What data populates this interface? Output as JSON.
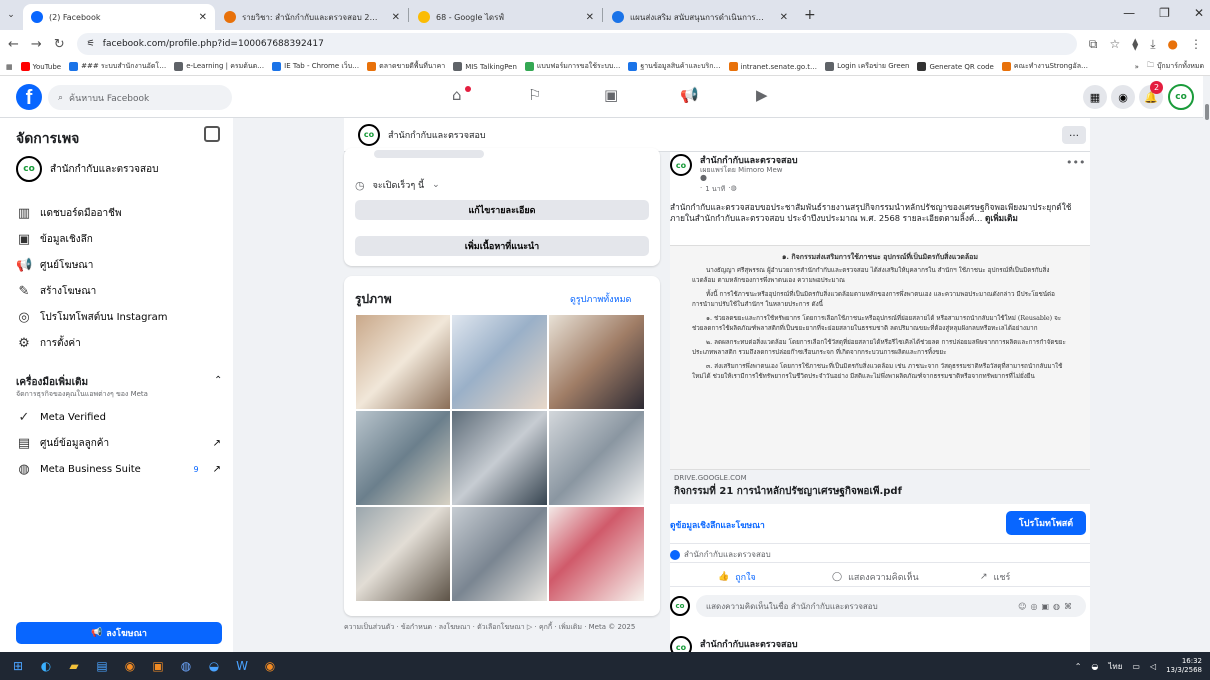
{
  "browser": {
    "tabs": [
      {
        "title": "(2) Facebook",
        "active": true,
        "fav_color": "#0866ff"
      },
      {
        "title": "รายวิชา: สำนักกำกับและตรวจสอบ 2…",
        "active": false,
        "fav_color": "#e8710a"
      },
      {
        "title": "68 - Google ไดรฟ์",
        "active": false,
        "fav_color": "#1a73e8"
      },
      {
        "title": "แผนส่งเสริม สนับสนุนการดำเนินการ…",
        "active": false,
        "fav_color": "#1a73e8"
      }
    ],
    "url": "facebook.com/profile.php?id=100067688392417",
    "bookmarks": [
      {
        "label": "YouTube",
        "color": "#ff0000"
      },
      {
        "label": "### ระบบสำนักงานอัตโ…",
        "color": "#1a73e8"
      },
      {
        "label": "e-Learning | ครมต้นต…",
        "color": "#5f6368"
      },
      {
        "label": "IE Tab - Chrome เว็บ…",
        "color": "#1a73e8"
      },
      {
        "label": "ตลาดขายดีพื้นที่นาคา",
        "color": "#e8710a"
      },
      {
        "label": "MIS TalkingPen",
        "color": "#5f6368"
      },
      {
        "label": "แบบฟอร์มการขอใช้ระบบ…",
        "color": "#34a853"
      },
      {
        "label": "ฐานข้อมูลสินค้าและบริก…",
        "color": "#1a73e8"
      },
      {
        "label": "intranet.senate.go.t…",
        "color": "#e8710a"
      },
      {
        "label": "Login เครือข่าย Green",
        "color": "#5f6368"
      },
      {
        "label": "Generate QR code",
        "color": "#333333"
      },
      {
        "label": "คณะทำงานStrongอัล…",
        "color": "#e8710a"
      }
    ],
    "bookmarks_folder": "บุ๊กมาร์กทั้งหมด"
  },
  "fb": {
    "search_placeholder": "ค้นหาบน Facebook",
    "notif_count": "2",
    "sidebar": {
      "title": "จัดการเพจ",
      "page_name": "สำนักกำกับและตรวจสอบ",
      "items": [
        {
          "label": "แดชบอร์ดมืออาชีพ",
          "icon": "dashboard-icon",
          "glyph": "▥"
        },
        {
          "label": "ข้อมูลเชิงลึก",
          "icon": "insights-icon",
          "glyph": "▣"
        },
        {
          "label": "ศูนย์โฆษณา",
          "icon": "megaphone-icon",
          "glyph": "📢"
        },
        {
          "label": "สร้างโฆษณา",
          "icon": "pencil-icon",
          "glyph": "✎"
        },
        {
          "label": "โปรโมทโพสต์บน Instagram",
          "icon": "instagram-icon",
          "glyph": "◎"
        },
        {
          "label": "การตั้งค่า",
          "icon": "gear-icon",
          "glyph": "⚙"
        }
      ],
      "tools_title": "เครื่องมือเพิ่มเติม",
      "tools_sub": "จัดการธุรกิจของคุณในแอพต่างๆ ของ Meta",
      "tools": [
        {
          "label": "Meta Verified",
          "icon": "verified-icon",
          "glyph": "✓",
          "badge": "",
          "arrow": ""
        },
        {
          "label": "ศูนย์ข้อมูลลูกค้า",
          "icon": "contacts-icon",
          "glyph": "▤",
          "badge": "",
          "arrow": "↗"
        },
        {
          "label": "Meta Business Suite",
          "icon": "business-suite-icon",
          "glyph": "◍",
          "badge": "9",
          "arrow": "↗"
        }
      ],
      "ad_button": "ลงโฆษณา"
    },
    "page_header": {
      "name": "สำนักกำกับและตรวจสอบ",
      "more": "…"
    },
    "intro": {
      "hours": "จะเปิดเร็วๆ นี้",
      "edit_details": "แก้ไขรายละเอียด",
      "add_featured": "เพิ่มเนื้อหาที่แนะนำ"
    },
    "photos": {
      "title": "รูปภาพ",
      "see_all": "ดูรูปภาพทั้งหมด"
    },
    "footer": "ความเป็นส่วนตัว · ข้อกำหนด · ลงโฆษณา · ตัวเลือกโฆษณา ▷ · คุกกี้ · เพิ่มเติม · Meta © 2025",
    "post": {
      "author": "สำนักกำกับและตรวจสอบ",
      "posted_by": "เผยแพร่โดย Mimoro Mew",
      "time": "1 นาที",
      "text1": "สำนักกำกับและตรวจสอบขอประชาสัมพันธ์รายงานสรุปกิจกรรมนำหลักปรัชญาของเศรษฐกิจพอเพียงมาประยุกต์ใช้",
      "text2": "ภายในสำนักกำกับและตรวจสอบ ประจำปีงบประมาณ พ.ศ. 2568 รายละเอียดตามลิ้งค์...",
      "see_more": "ดูเพิ่มเติม",
      "doc_heading": "๑. กิจกรรมส่งเสริมการใช้ภาชนะ อุปกรณ์ที่เป็นมิตรกับสิ่งแวดล้อม",
      "doc_p1": "นางธัญญา ศรีสุพรรณ ผู้อำนวยการสำนักกำกับและตรวจสอบ ได้ส่งเสริมให้บุคลากรใน สำนักฯ ใช้ภาชนะ อุปกรณ์ที่เป็นมิตรกับสิ่งแวดล้อม ตามหลักของการพึ่งพาตนเอง ความพอประมาณ",
      "doc_p2": "ทั้งนี้ การใช้ภาชนะหรืออุปกรณ์ที่เป็นมิตรกับสิ่งแวดล้อมตามหลักของการพึ่งพาตนเอง และความพอประมาณดังกล่าว มีประโยชน์ต่อการนำมาปรับใช้ในสำนักฯ ในหลายประการ ดังนี้",
      "doc_p3": "๑. ช่วยลดขยะและการใช้ทรัพยากร โดยการเลือกใช้ภาชนะหรืออุปกรณ์ที่ย่อยสลายได้ หรือสามารถนำกลับมาใช้ใหม่ (Reusable) จะช่วยลดการใช้ผลิตภัณฑ์พลาสติกที่เป็นขยะยากที่จะย่อยสลายในธรรมชาติ ลดปริมาณขยะที่ต้องสู่หลุมฝังกลบหรือทะเลได้อย่างมาก",
      "doc_p4": "๒. ลดผลกระทบต่อสิ่งแวดล้อม โดยการเลือกใช้วัสดุที่ย่อยสลายได้หรือรีไซเคิลได้ช่วยลด การปล่อยมลพิษจากการผลิตและการกำจัดขยะประเภทพลาสติก รวมถึงลดการปล่อยก๊าซเรือนกระจก ที่เกิดจากกระบวนการผลิตและการทิ้งขยะ",
      "doc_p5": "๓. ส่งเสริมการพึ่งพาตนเอง โดยการใช้ภาชนะที่เป็นมิตรกับสิ่งแวดล้อม เช่น ภาชนะจาก วัสดุธรรมชาติหรือวัสดุที่สามารถนำกลับมาใช้ใหม่ได้ ช่วยให้เรามีการใช้ทรัพยากรในชีวิตประจำวันอย่าง มีสติและไม่พึ่งพาผลิตภัณฑ์จากธรรมชาติหรือจากทรัพยากรที่ไม่ยั่งยืน",
      "link_domain": "DRIVE.GOOGLE.COM",
      "link_title": "กิจกรรมที่ 21 การนำหลักปรัชญาเศรษฐกิจพอเพี.pdf",
      "insights_link": "ดูข้อมูลเชิงลึกและโฆษณา",
      "promote": "โปรโมทโพสต์",
      "reaction_name": "สำนักกำกับและตรวจสอบ",
      "like": "ถูกใจ",
      "comment": "แสดงความคิดเห็น",
      "share": "แชร์",
      "comment_placeholder": "แสดงความคิดเห็นในชื่อ สำนักกำกับและตรวจสอบ"
    },
    "next_post_author": "สำนักกำกับและตรวจสอบ"
  },
  "taskbar": {
    "lang": "ไทย",
    "time": "16:32",
    "date": "13/3/2568"
  },
  "colors": {
    "fb_blue": "#0866ff",
    "taskbar": "#1f2733"
  }
}
